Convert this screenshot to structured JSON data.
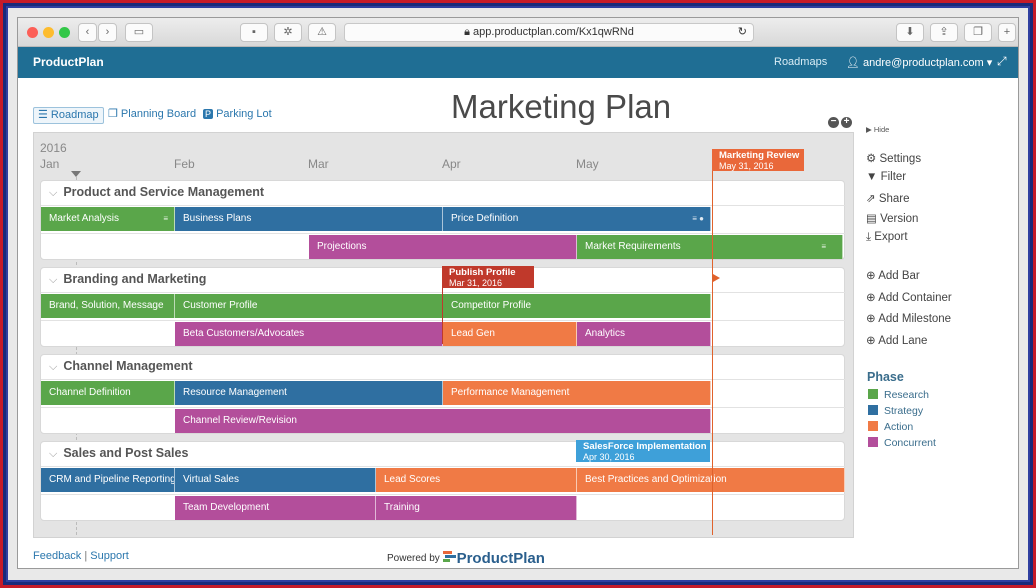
{
  "browser": {
    "url": "app.productplan.com/Kx1qwRNd"
  },
  "header": {
    "brand": "ProductPlan",
    "roadmaps": "Roadmaps",
    "user": "andre@productplan.com ▾"
  },
  "tabs": [
    {
      "label": "Roadmap"
    },
    {
      "label": "Planning Board"
    },
    {
      "label": "Parking Lot"
    }
  ],
  "page_title": "Marketing Plan",
  "timeline": {
    "year": "2016",
    "months": [
      "Jan",
      "Feb",
      "Mar",
      "Apr",
      "May"
    ]
  },
  "lanes": [
    {
      "title": "Product and Service Management",
      "bars": [
        {
          "label": "Market Analysis",
          "phase": "research"
        },
        {
          "label": "Business Plans",
          "phase": "strategy"
        },
        {
          "label": "Price Definition",
          "phase": "strategy"
        },
        {
          "label": "Projections",
          "phase": "concurrent"
        },
        {
          "label": "Market Requirements",
          "phase": "research"
        }
      ]
    },
    {
      "title": "Branding and Marketing",
      "bars": [
        {
          "label": "Brand, Solution, Message",
          "phase": "research"
        },
        {
          "label": "Customer Profile",
          "phase": "research"
        },
        {
          "label": "Competitor Profile",
          "phase": "research"
        },
        {
          "label": "Beta Customers/Advocates",
          "phase": "concurrent"
        },
        {
          "label": "Lead Gen",
          "phase": "action"
        },
        {
          "label": "Analytics",
          "phase": "concurrent"
        }
      ]
    },
    {
      "title": "Channel Management",
      "bars": [
        {
          "label": "Channel Definition",
          "phase": "research"
        },
        {
          "label": "Resource Management",
          "phase": "strategy"
        },
        {
          "label": "Performance Management",
          "phase": "action"
        },
        {
          "label": "Channel Review/Revision",
          "phase": "concurrent"
        }
      ]
    },
    {
      "title": "Sales and Post Sales",
      "bars": [
        {
          "label": "CRM and Pipeline Reporting",
          "phase": "strategy"
        },
        {
          "label": "Virtual Sales",
          "phase": "strategy"
        },
        {
          "label": "Lead Scores",
          "phase": "action"
        },
        {
          "label": "Best Practices and Optimization",
          "phase": "action"
        },
        {
          "label": "Team Development",
          "phase": "concurrent"
        },
        {
          "label": "Training",
          "phase": "concurrent"
        }
      ]
    }
  ],
  "milestones": [
    {
      "title": "Marketing Review",
      "date": "May 31, 2016"
    },
    {
      "title": "Publish Profile",
      "date": "Mar 31, 2016"
    },
    {
      "title": "SalesForce Implementation",
      "date": "Apr 30, 2016"
    }
  ],
  "sidebar": {
    "hide": "Hide",
    "actions": [
      "Settings",
      "Filter",
      "Share",
      "Version",
      "Export"
    ],
    "add_actions": [
      "Add Bar",
      "Add Container",
      "Add Milestone",
      "Add Lane"
    ]
  },
  "phase": {
    "title": "Phase",
    "items": [
      {
        "label": "Research",
        "color": "#5aa64a"
      },
      {
        "label": "Strategy",
        "color": "#2f6fa1"
      },
      {
        "label": "Action",
        "color": "#f07a45"
      },
      {
        "label": "Concurrent",
        "color": "#b34e9b"
      }
    ]
  },
  "footer": {
    "feedback": "Feedback",
    "separator": "|",
    "support": "Support",
    "powered_by": "Powered by",
    "logo_text": "ProductPlan"
  }
}
